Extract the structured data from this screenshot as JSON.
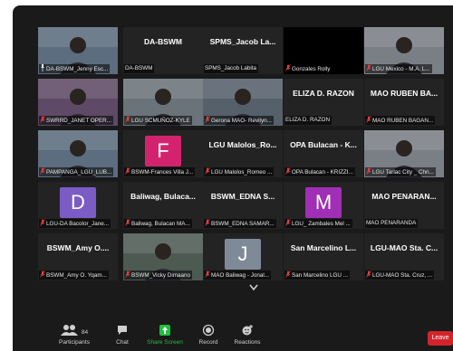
{
  "colors": {
    "background": "#1a1a1a",
    "tile": "#232323",
    "active_border": "#d6e23a",
    "leave": "#d3242c",
    "share": "#1fbf3f",
    "muted_mic": "#e04040"
  },
  "tiles": [
    {
      "label": "DA-BSWM_Jenny Esc...",
      "name": "",
      "kind": "video",
      "active": true,
      "pinned": true,
      "muted": false
    },
    {
      "label": "DA-BSWM",
      "name": "DA-BSWM",
      "kind": "name",
      "muted": false
    },
    {
      "label": "SPMS_Jacob Labita",
      "name": "SPMS_Jacob La...",
      "kind": "name",
      "muted": false
    },
    {
      "label": "Gonzales Rolly",
      "name": "",
      "kind": "black",
      "muted": true
    },
    {
      "label": "LGU Mexico -  M.A. L...",
      "name": "",
      "kind": "video",
      "muted": true
    },
    {
      "label": "SWRRD_JANET OPER...",
      "name": "",
      "kind": "video",
      "muted": true
    },
    {
      "label": "LGU SCMUÑOZ-KYLE",
      "name": "",
      "kind": "video",
      "muted": true
    },
    {
      "label": "Gerona MAO- Revilyn...",
      "name": "",
      "kind": "video",
      "muted": true
    },
    {
      "label": "ELIZA D. RAZON",
      "name": "ELIZA D. RAZON",
      "kind": "name",
      "muted": false
    },
    {
      "label": "MAO RUBEN BAGAN...",
      "name": "MAO RUBEN BA...",
      "kind": "name",
      "muted": true
    },
    {
      "label": "PAMPANGA_LGU_LUB...",
      "name": "",
      "kind": "video",
      "muted": true
    },
    {
      "label": "BSWM-Frances Villa J...",
      "name": "F",
      "kind": "letter",
      "color": "#d4236e",
      "muted": true
    },
    {
      "label": "LGU Malolos_Romeo ...",
      "name": "LGU Malolos_Ro...",
      "kind": "name",
      "muted": true
    },
    {
      "label": "OPA Bulacan - KRIZZI...",
      "name": "OPA Bulacan - K...",
      "kind": "name",
      "muted": true
    },
    {
      "label": "LGU Tarlac City _ Chri...",
      "name": "",
      "kind": "video",
      "muted": true
    },
    {
      "label": "LGU-DA Bacolor_Jane...",
      "name": "D",
      "kind": "letter",
      "color": "#7b5cc4",
      "muted": true
    },
    {
      "label": "Baliwag, Bulacan MA...",
      "name": "Baliwag,  Bulaca...",
      "kind": "name",
      "muted": true
    },
    {
      "label": "BSWM_EDNA SAMAR...",
      "name": "BSWM_EDNA  S...",
      "kind": "name",
      "muted": true
    },
    {
      "label": "LGU_ Zambales Mel ...",
      "name": "M",
      "kind": "letter",
      "color": "#a02fb5",
      "muted": true
    },
    {
      "label": "MAO PENARANDA",
      "name": "MAO PENARAN...",
      "kind": "name",
      "muted": false
    },
    {
      "label": "BSWM_Amy O. Yqam...",
      "name": "BSWM_Amy  O....",
      "kind": "name",
      "muted": true
    },
    {
      "label": "BSWM_Vicky Dimaano",
      "name": "",
      "kind": "video",
      "muted": true
    },
    {
      "label": "MAO Baliwag - Jonal...",
      "name": "J",
      "kind": "letter",
      "color": "#7f8a99",
      "muted": true
    },
    {
      "label": "San Marcelino LGU ...",
      "name": "San Marcelino L...",
      "kind": "name",
      "muted": true
    },
    {
      "label": "LGU-MAO Sta. Cruz, ...",
      "name": "LGU-MAO Sta. C...",
      "kind": "name",
      "muted": true
    }
  ],
  "toolbar": {
    "participants_label": "Participants",
    "participants_count": "84",
    "chat_label": "Chat",
    "share_label": "Share Screen",
    "record_label": "Record",
    "reactions_label": "Reactions",
    "leave_label": "Leave"
  },
  "icons": {
    "participants": "people-icon",
    "chat": "chat-bubble-icon",
    "share": "share-arrow-icon",
    "record": "record-icon",
    "reactions": "emoji-plus-icon",
    "more": "chevron-down-icon",
    "mute": "muted-mic-icon",
    "pin": "pin-icon"
  }
}
